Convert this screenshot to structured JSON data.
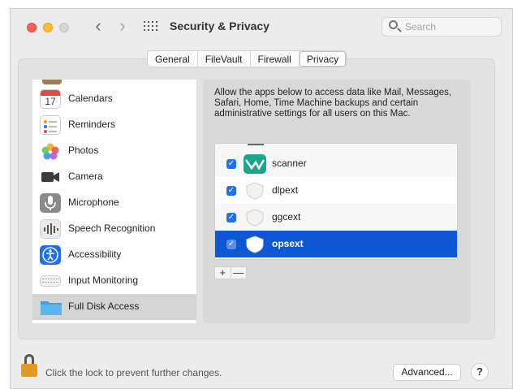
{
  "window": {
    "title": "Security & Privacy",
    "back_glyph": "‹",
    "forward_glyph": "›",
    "search": {
      "placeholder": "Search",
      "value": ""
    }
  },
  "tabs": [
    {
      "label": "General",
      "active": false
    },
    {
      "label": "FileVault",
      "active": false
    },
    {
      "label": "Firewall",
      "active": false
    },
    {
      "label": "Privacy",
      "active": true
    }
  ],
  "sidebar": {
    "items": [
      {
        "label": "Calendars",
        "icon": "calendar-icon",
        "icon_text": "17",
        "selected": false
      },
      {
        "label": "Reminders",
        "icon": "reminders-icon",
        "selected": false
      },
      {
        "label": "Photos",
        "icon": "photos-icon",
        "selected": false
      },
      {
        "label": "Camera",
        "icon": "camera-icon",
        "selected": false
      },
      {
        "label": "Microphone",
        "icon": "microphone-icon",
        "selected": false
      },
      {
        "label": "Speech Recognition",
        "icon": "speech-recognition-icon",
        "selected": false
      },
      {
        "label": "Accessibility",
        "icon": "accessibility-icon",
        "selected": false
      },
      {
        "label": "Input Monitoring",
        "icon": "keyboard-icon",
        "selected": false
      },
      {
        "label": "Full Disk Access",
        "icon": "folder-icon",
        "selected": true
      }
    ]
  },
  "content": {
    "description": "Allow the apps below to access data like Mail, Messages, Safari, Home, Time Machine backups and certain administrative settings for all users on this Mac.",
    "apps": [
      {
        "name": "scanner",
        "checked": true,
        "selected": false,
        "icon": "scanner-app-icon"
      },
      {
        "name": "dlpext",
        "checked": true,
        "selected": false,
        "icon": "shield-extension-icon"
      },
      {
        "name": "ggcext",
        "checked": true,
        "selected": false,
        "icon": "shield-extension-icon"
      },
      {
        "name": "opsext",
        "checked": true,
        "selected": true,
        "icon": "shield-extension-icon"
      }
    ],
    "add_label": "+",
    "remove_label": "—"
  },
  "footer": {
    "lock_message": "Click the lock to prevent further changes.",
    "advanced_label": "Advanced...",
    "help_label": "?"
  },
  "colors": {
    "accent": "#0e58d5",
    "checkbox": "#1f6ff2",
    "lock": "#e19a28"
  }
}
